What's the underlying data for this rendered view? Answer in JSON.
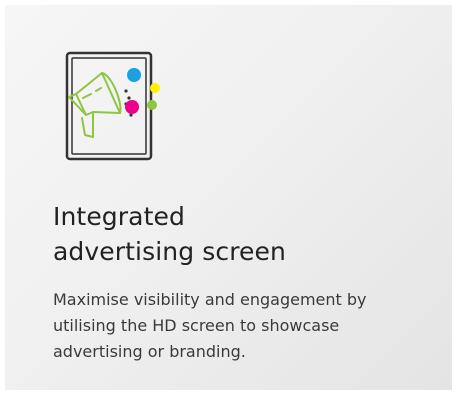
{
  "feature": {
    "icon": "megaphone-screen-icon",
    "title_lines": [
      "Integrated",
      "advertising screen"
    ],
    "description": "Maximise visibility and engagement by utilising the HD screen to showcase advertising or branding."
  },
  "colors": {
    "icon_outline": "#333333",
    "megaphone": "#8dc63f",
    "dot_blue": "#1ba1e2",
    "dot_yellow": "#fff200",
    "dot_magenta": "#ec008c",
    "dot_green": "#8dc63f"
  }
}
